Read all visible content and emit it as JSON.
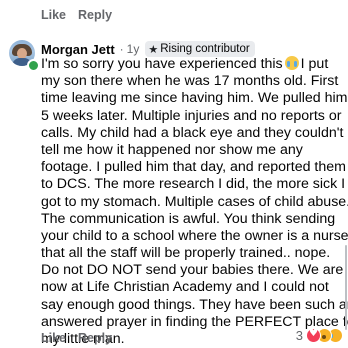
{
  "previous_comment": {
    "actions": {
      "like_label": "Like",
      "reply_label": "Reply"
    }
  },
  "comment": {
    "author": "Morgan Jett",
    "separator": "·",
    "timestamp": "1y",
    "badge": {
      "icon": "star-icon",
      "label": "Rising contributor"
    },
    "online": true,
    "lines": [
      "I'm so sorry you have experienced this",
      "my son there when he was 17 months old. First",
      "time leaving me since having him. We pulled him",
      "5 weeks later. Multiple injuries and no reports or",
      "calls. My child had a black eye and they couldn't",
      "tell me how it happened nor show me any",
      "footage. I pulled him that day, and reported them",
      "to DCS. The more research I did, the more sick I",
      "got to my stomach. Multiple cases of child abuse.",
      "The communication is awful. You think sending",
      "your child to a school where the owner is a nurse",
      "that all the staff will be properly trained.. nope.",
      "Do not DO NOT send your babies there. We are",
      "now at Life Christian Academy and I could not",
      "say enough good things. They have been such an",
      "answered prayer in finding the PERFECT place for",
      "my little man."
    ],
    "line1_after_emoji": "I put",
    "emoji": "crying-face-emoji",
    "actions": {
      "like_label": "Like",
      "reply_label": "Reply"
    },
    "reactions": {
      "count": "3",
      "types": [
        "love",
        "wow",
        "sad"
      ]
    }
  },
  "colors": {
    "meta_gray": "#65676b",
    "text": "#050505",
    "badge_bg": "#e9ebee",
    "online": "#31a24c"
  }
}
